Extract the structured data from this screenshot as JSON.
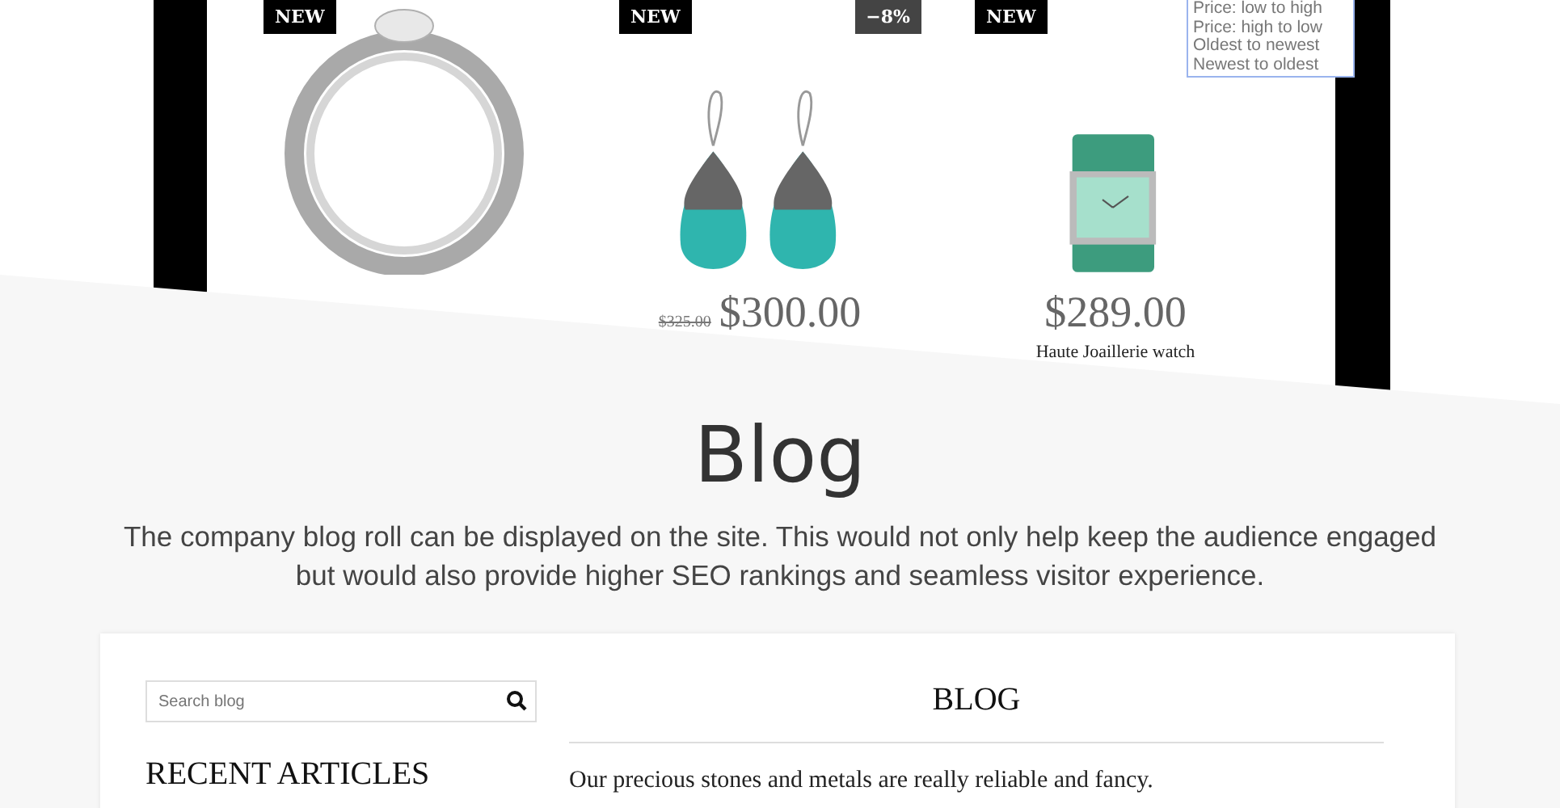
{
  "products": [
    {
      "kind": "ring",
      "badges": [
        {
          "label": "NEW",
          "kind": "new"
        }
      ]
    },
    {
      "kind": "earrings",
      "badges": [
        {
          "label": "NEW",
          "kind": "new"
        },
        {
          "label": "−8%",
          "kind": "sale"
        }
      ],
      "old_price": "$325.00",
      "price": "$300.00"
    },
    {
      "kind": "watch",
      "badges": [
        {
          "label": "NEW",
          "kind": "new"
        }
      ],
      "price": "$289.00",
      "name": "Haute Joaillerie watch"
    }
  ],
  "sort_menu": {
    "options": [
      "Price: low to high",
      "Price: high to low",
      "Oldest to newest",
      "Newest to oldest"
    ]
  },
  "blog": {
    "title": "Blog",
    "intro": "The company blog roll can be displayed on the site. This would not only help keep the audience engaged but would also provide higher SEO rankings and seamless visitor experience."
  },
  "blog_panel": {
    "search": {
      "placeholder": "Search blog"
    },
    "recent_heading": "RECENT ARTICLES",
    "heading": "BLOG",
    "excerpt": "Our precious stones and metals are really reliable and fancy."
  }
}
